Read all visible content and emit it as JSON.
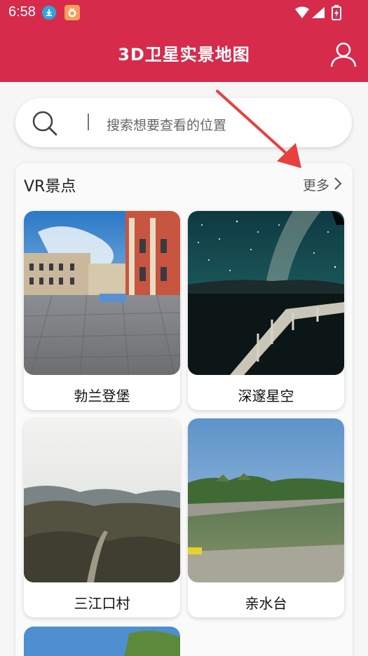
{
  "status_bar": {
    "time": "6:58",
    "icons": [
      "download-icon",
      "app-badge-icon",
      "wifi-icon",
      "signal-icon",
      "battery-icon"
    ]
  },
  "header": {
    "title": "3D卫星实景地图",
    "background": "#d62b4b"
  },
  "search": {
    "placeholder": "搜索想要查看的位置"
  },
  "section": {
    "title": "VR景点",
    "more_label": "更多"
  },
  "cards": [
    {
      "label": "勃兰登堡"
    },
    {
      "label": "深邃星空"
    },
    {
      "label": "三江口村"
    },
    {
      "label": "亲水台"
    }
  ],
  "colors": {
    "accent": "#d62b4b",
    "annotation": "#e8403f"
  }
}
